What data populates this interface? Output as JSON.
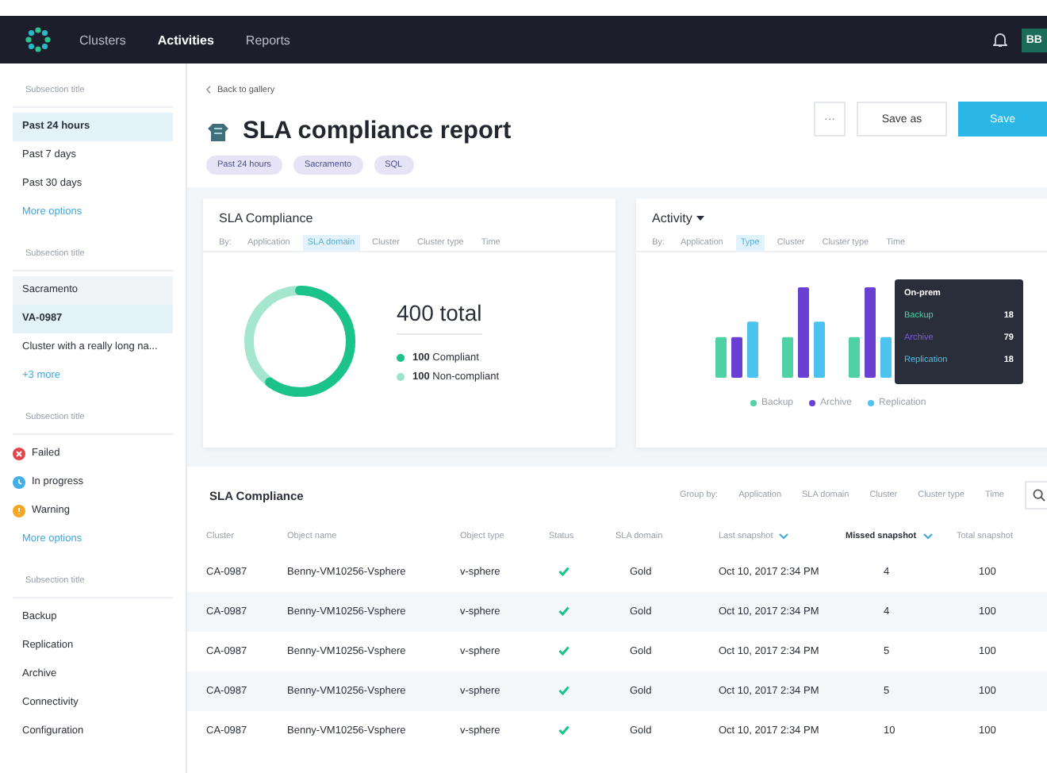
{
  "nav": {
    "items": [
      {
        "label": "Clusters",
        "selected": false
      },
      {
        "label": "Activities",
        "selected": true
      },
      {
        "label": "Reports",
        "selected": false
      }
    ],
    "avatar": "BB"
  },
  "sidebar": {
    "sections": [
      {
        "title": "Subsection title",
        "kind": "list",
        "items": [
          {
            "label": "Past 24 hours",
            "selected": true,
            "hovered": false
          },
          {
            "label": "Past 7 days",
            "selected": false,
            "hovered": false
          },
          {
            "label": "Past 30 days",
            "selected": false,
            "hovered": false
          }
        ],
        "link": "More options"
      },
      {
        "title": "Subsection title",
        "kind": "list",
        "items": [
          {
            "label": "Sacramento",
            "selected": false,
            "hovered": true
          },
          {
            "label": "VA-0987",
            "selected": true,
            "hovered": false
          },
          {
            "label": "Cluster with a really long na...",
            "selected": false,
            "hovered": false
          }
        ],
        "link": "+3 more"
      },
      {
        "title": "Subsection title",
        "kind": "status",
        "items": [
          {
            "label": "Failed",
            "kind": "failed",
            "color": "#e0474c"
          },
          {
            "label": "In progress",
            "kind": "progress",
            "color": "#3fb0e8"
          },
          {
            "label": "Warning",
            "kind": "warning",
            "color": "#f5a623"
          }
        ],
        "link": "More options"
      },
      {
        "title": "Subsection title",
        "kind": "list",
        "items": [
          {
            "label": "Backup",
            "selected": false,
            "hovered": false
          },
          {
            "label": "Replication",
            "selected": false,
            "hovered": false
          },
          {
            "label": "Archive",
            "selected": false,
            "hovered": false
          },
          {
            "label": "Connectivity",
            "selected": false,
            "hovered": false
          },
          {
            "label": "Configuration",
            "selected": false,
            "hovered": false
          }
        ]
      }
    ]
  },
  "header": {
    "back": "Back to gallery",
    "title": "SLA compliance report",
    "chips": [
      "Past 24 hours",
      "Sacramento",
      "SQL"
    ],
    "buttons": [
      {
        "kind": "more",
        "label": "···"
      },
      {
        "kind": "secondary",
        "label": "Save as"
      },
      {
        "kind": "primary",
        "label": "Save"
      }
    ]
  },
  "compliance_card": {
    "title": "SLA Compliance",
    "by": "By:",
    "filters": [
      {
        "label": "Application",
        "selected": false
      },
      {
        "label": "SLA domain",
        "selected": true
      },
      {
        "label": "Cluster",
        "selected": false
      },
      {
        "label": "Cluster type",
        "selected": false
      },
      {
        "label": "Time",
        "selected": false
      }
    ],
    "total": "400 total",
    "legend": [
      {
        "text": "**100** Compliant",
        "color": "#1bc38b"
      },
      {
        "text": "**100** Non-compliant",
        "color": "#9be3c9"
      }
    ]
  },
  "activity_card": {
    "title": "Activity",
    "by": "By:",
    "filters": [
      {
        "label": "Application",
        "selected": false
      },
      {
        "label": "Type",
        "selected": true
      },
      {
        "label": "Cluster",
        "selected": false
      },
      {
        "label": "Cluster type",
        "selected": false
      },
      {
        "label": "Time",
        "selected": false
      }
    ],
    "legend": [
      {
        "label": "Backup",
        "color": "#4fd1a5"
      },
      {
        "label": "Archive",
        "color": "#6a3fd4"
      },
      {
        "label": "Replication",
        "color": "#4cc3ee"
      }
    ],
    "tooltip": {
      "title": "On-prem",
      "rows": [
        {
          "label": "Backup",
          "value": "18",
          "color": "#4fd1a5"
        },
        {
          "label": "Archive",
          "value": "79",
          "color": "#7b5ce0"
        },
        {
          "label": "Replication",
          "value": "18",
          "color": "#4cc3ee"
        }
      ]
    }
  },
  "table": {
    "title": "SLA Compliance",
    "group_by": "Group by:",
    "options": [
      "Application",
      "SLA domain",
      "Cluster",
      "Cluster type",
      "Time"
    ],
    "columns": [
      {
        "label": "Cluster",
        "sortable": false,
        "active": false
      },
      {
        "label": "Object name",
        "sortable": false,
        "active": false
      },
      {
        "label": "Object type",
        "sortable": false,
        "active": false
      },
      {
        "label": "Status",
        "sortable": false,
        "active": false
      },
      {
        "label": "SLA domain",
        "sortable": false,
        "active": false
      },
      {
        "label": "Last snapshot",
        "sortable": true,
        "active": false
      },
      {
        "label": "Missed snapshot",
        "sortable": true,
        "active": true
      },
      {
        "label": "Total snapshot",
        "sortable": false,
        "active": false
      }
    ],
    "rows": [
      {
        "cluster": "CA-0987",
        "object_name": "Benny-VM10256-Vsphere",
        "object_type": "v-sphere",
        "compliant": true,
        "sla_domain": "Gold",
        "last_snapshot": "Oct 10, 2017 2:34 PM",
        "missed_snapshot": "4",
        "total_snapshot": "100"
      },
      {
        "cluster": "CA-0987",
        "object_name": "Benny-VM10256-Vsphere",
        "object_type": "v-sphere",
        "compliant": true,
        "sla_domain": "Gold",
        "last_snapshot": "Oct 10, 2017 2:34 PM",
        "missed_snapshot": "4",
        "total_snapshot": "100"
      },
      {
        "cluster": "CA-0987",
        "object_name": "Benny-VM10256-Vsphere",
        "object_type": "v-sphere",
        "compliant": true,
        "sla_domain": "Gold",
        "last_snapshot": "Oct 10, 2017 2:34 PM",
        "missed_snapshot": "5",
        "total_snapshot": "100"
      },
      {
        "cluster": "CA-0987",
        "object_name": "Benny-VM10256-Vsphere",
        "object_type": "v-sphere",
        "compliant": true,
        "sla_domain": "Gold",
        "last_snapshot": "Oct 10, 2017 2:34 PM",
        "missed_snapshot": "5",
        "total_snapshot": "100"
      },
      {
        "cluster": "CA-0987",
        "object_name": "Benny-VM10256-Vsphere",
        "object_type": "v-sphere",
        "compliant": true,
        "sla_domain": "Gold",
        "last_snapshot": "Oct 10, 2017 2:34 PM",
        "missed_snapshot": "10",
        "total_snapshot": "100"
      }
    ]
  }
}
